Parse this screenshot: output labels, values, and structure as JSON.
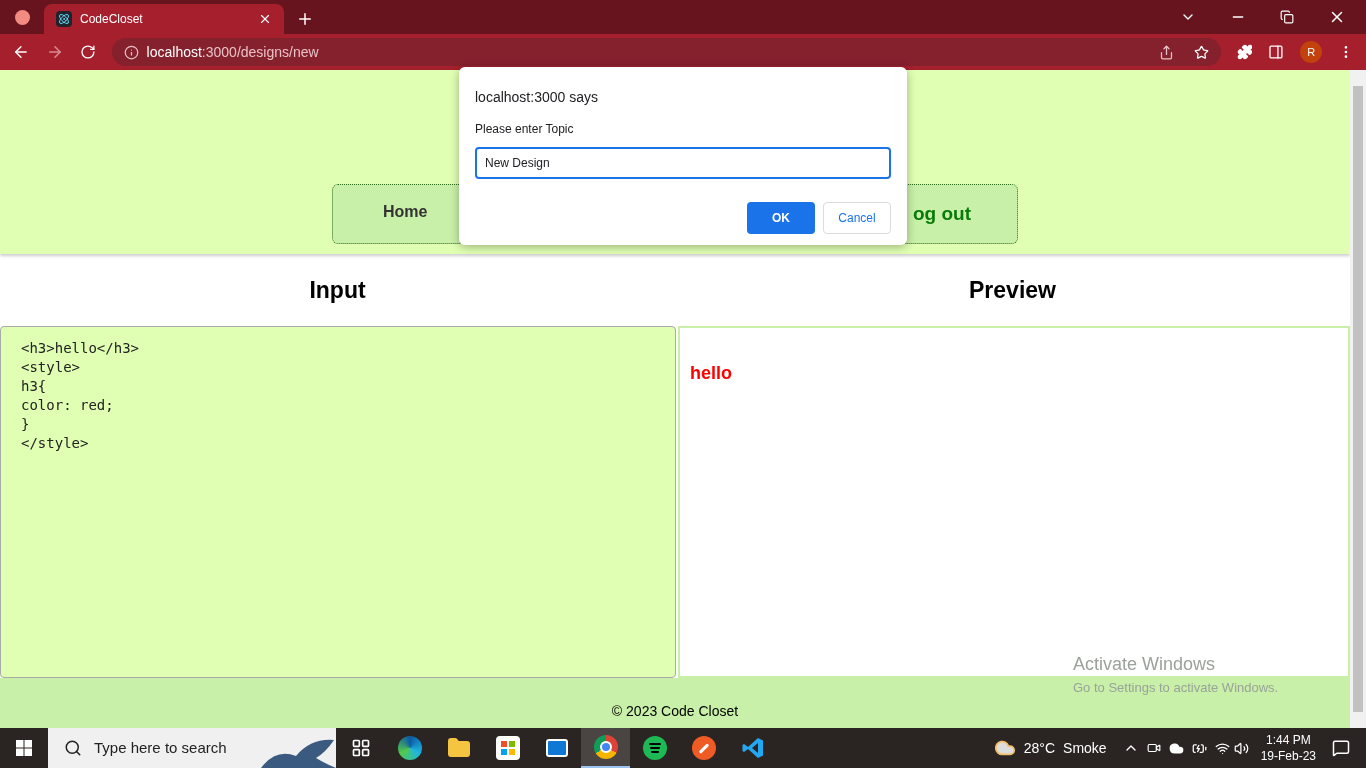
{
  "browser": {
    "tab": {
      "title": "CodeCloset",
      "selected": true
    },
    "address": {
      "host": "localhost",
      "rest": ":3000/designs/new"
    },
    "profile": "R"
  },
  "nav": {
    "items": [
      {
        "label": "Home"
      },
      {
        "label": "og out"
      }
    ]
  },
  "dialog": {
    "title": "localhost:3000 says",
    "message": "Please enter Topic",
    "value": "New Design",
    "ok": "OK",
    "cancel": "Cancel"
  },
  "input_panel": {
    "title": "Input",
    "code": "<h3>hello</h3>\n<style>\nh3{\ncolor: red;\n}\n</style>"
  },
  "preview_panel": {
    "title": "Preview",
    "heading": "hello"
  },
  "footer": "© 2023 Code Closet",
  "activation": {
    "title": "Activate Windows",
    "note": "Go to Settings to activate Windows."
  },
  "taskbar": {
    "search_placeholder": "Type here to search",
    "apps": [
      {
        "kind": "taskview",
        "selected": false
      },
      {
        "kind": "edge",
        "selected": false
      },
      {
        "kind": "folder",
        "selected": false
      },
      {
        "kind": "store",
        "selected": false
      },
      {
        "kind": "mail",
        "selected": false
      },
      {
        "kind": "chrome",
        "selected": true
      },
      {
        "kind": "spotify",
        "selected": false
      },
      {
        "kind": "postman",
        "selected": false
      },
      {
        "kind": "vscode",
        "selected": false
      }
    ],
    "weather": {
      "temp": "28°C",
      "condition": "Smoke"
    },
    "time": "1:44 PM",
    "date": "19-Feb-23"
  }
}
